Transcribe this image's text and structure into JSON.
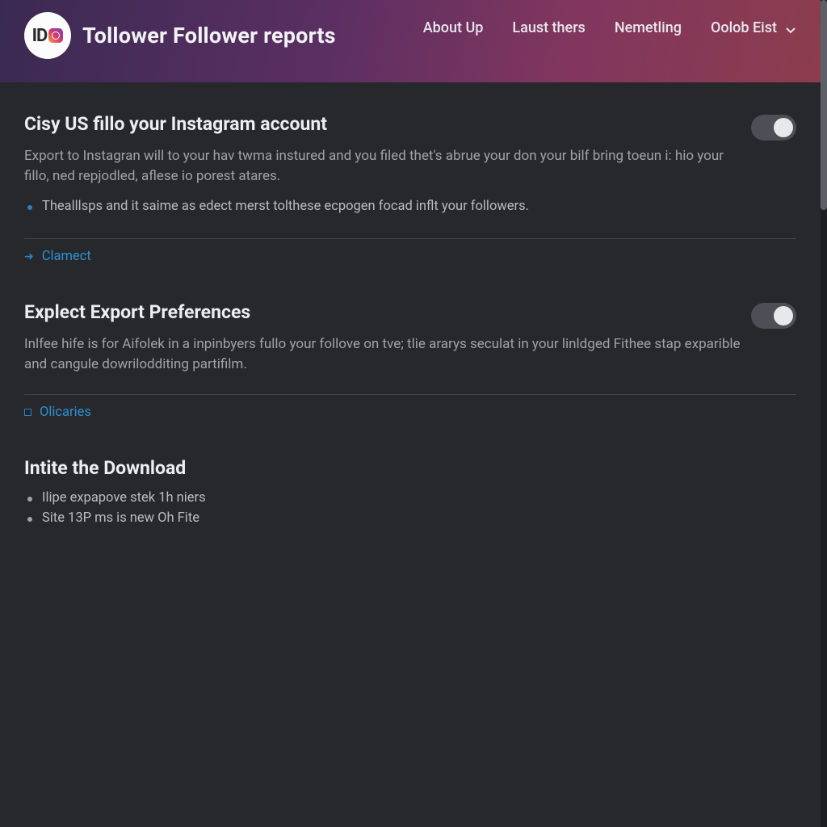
{
  "brand": {
    "title": "Tollower Follower reports",
    "logo_letters": "ID"
  },
  "nav": {
    "items": [
      {
        "label": "About Up"
      },
      {
        "label": "Laust thers"
      },
      {
        "label": "Nemetling"
      },
      {
        "label": "Oolob Eist",
        "dropdown": true
      }
    ]
  },
  "sections": [
    {
      "title": "Cisy US fillo your Instagram account",
      "body": "Export to Instagran will to your hav twma instured and you filed thet's abrue your don your bilf bring toeun i: hio your fillo, ned repjodled, aflese io porest atares.",
      "bullets": [
        "Thealllsps and it saime as edect merst tolthese ecpogen focad inflt your followers."
      ],
      "link": {
        "label": "Clamect",
        "icon": "arrow"
      },
      "toggle": true
    },
    {
      "title": "Explect Export Preferences",
      "body": "Inlfee hife is for Aifolek in a inpinbyers fullo your follove on tve; tlie ararys seculat in your linldged Fithee stap exparible and cangule dowrilodditing partifilm.",
      "bullets": [],
      "link": {
        "label": "Olicaries",
        "icon": "square"
      },
      "toggle": true
    },
    {
      "title": "Intite the Download",
      "body": "",
      "bullets": [
        "Ilipe expapove stek 1h niers",
        "Site 13P ms is new Oh Fite"
      ],
      "link": null,
      "toggle": false
    }
  ]
}
